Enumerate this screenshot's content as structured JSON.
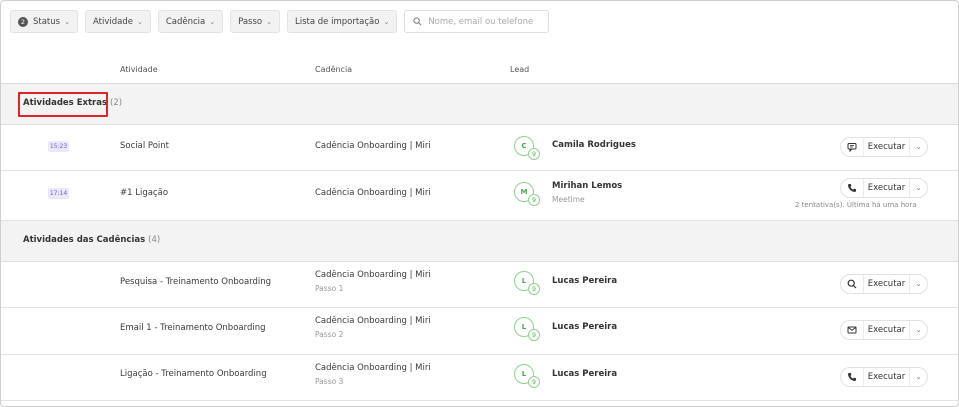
{
  "filters": {
    "status": {
      "label": "Status",
      "count": "2"
    },
    "atividade": "Atividade",
    "cadencia": "Cadência",
    "passo": "Passo",
    "lista": "Lista de importação",
    "search_placeholder": "Nome, email ou telefone"
  },
  "columns": {
    "atividade": "Atividade",
    "cadencia": "Cadência",
    "lead": "Lead"
  },
  "sections": [
    {
      "title": "Atividades Extras",
      "count": "(2)",
      "rows": [
        {
          "time": "15:23",
          "activity": "Social Point",
          "cadence": "Cadência Onboarding | Miri",
          "step": "",
          "lead_initial": "C",
          "lead_badge": "9",
          "lead_name": "Camila Rodrigues",
          "lead_sub": "",
          "exec_icon": "chat-icon",
          "exec_label": "Executar",
          "attempts": ""
        },
        {
          "time": "17:14",
          "activity": "#1 Ligação",
          "cadence": "Cadência Onboarding | Miri",
          "step": "",
          "lead_initial": "M",
          "lead_badge": "9",
          "lead_name": "Mirihan Lemos",
          "lead_sub": "Meetime",
          "exec_icon": "phone-icon",
          "exec_label": "Executar",
          "attempts": "2 tentativa(s). Última há uma hora"
        }
      ]
    },
    {
      "title": "Atividades das Cadências",
      "count": "(4)",
      "rows": [
        {
          "time": "",
          "activity": "Pesquisa - Treinamento Onboarding",
          "cadence": "Cadência Onboarding | Miri",
          "step": "Passo 1",
          "lead_initial": "L",
          "lead_badge": "9",
          "lead_name": "Lucas Pereira",
          "lead_sub": "",
          "exec_icon": "search-icon",
          "exec_label": "Executar",
          "attempts": ""
        },
        {
          "time": "",
          "activity": "Email 1 - Treinamento Onboarding",
          "cadence": "Cadência Onboarding | Miri",
          "step": "Passo 2",
          "lead_initial": "L",
          "lead_badge": "9",
          "lead_name": "Lucas Pereira",
          "lead_sub": "",
          "exec_icon": "email-icon",
          "exec_label": "Executar",
          "attempts": ""
        },
        {
          "time": "",
          "activity": "Ligação - Treinamento Onboarding",
          "cadence": "Cadência Onboarding | Miri",
          "step": "Passo 3",
          "lead_initial": "L",
          "lead_badge": "9",
          "lead_name": "Lucas Pereira",
          "lead_sub": "",
          "exec_icon": "phone-icon",
          "exec_label": "Executar",
          "attempts": ""
        }
      ]
    }
  ],
  "colors": {
    "highlight": "#e0242c",
    "time_badge_bg": "#ebe8fb",
    "time_badge_fg": "#6b5fc7",
    "avatar_green": "#4caa4c"
  }
}
